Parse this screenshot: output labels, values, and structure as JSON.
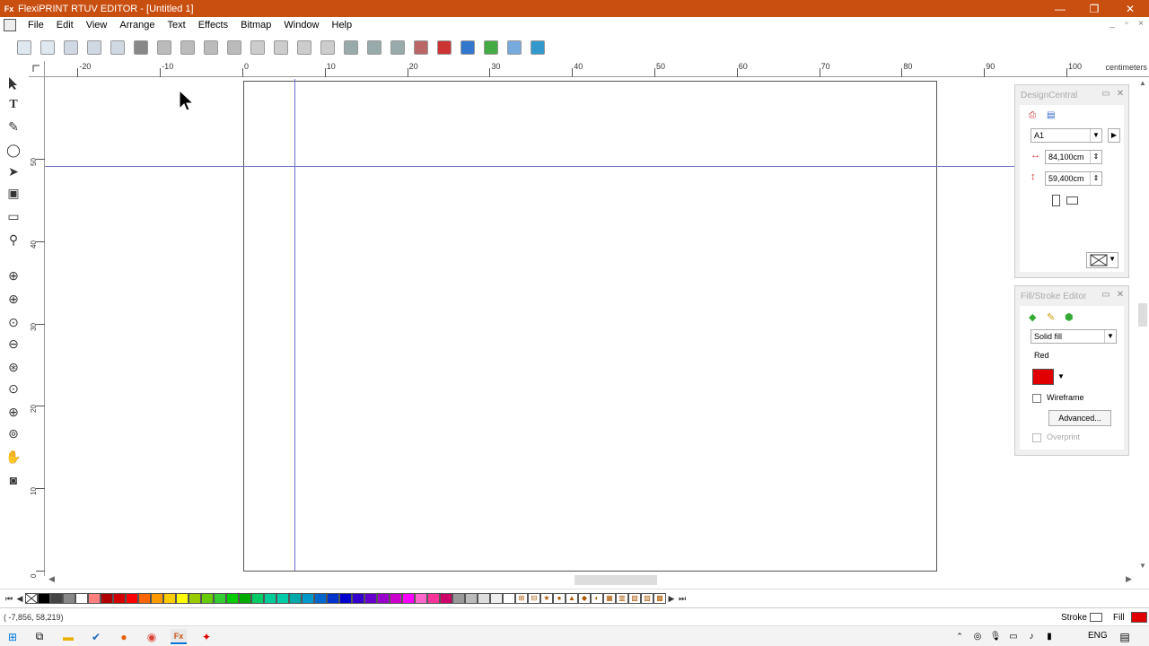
{
  "window": {
    "app_icon": "Fx",
    "title": "FlexiPRINT RTUV EDITOR - [Untitled 1]",
    "controls": {
      "minimize": "—",
      "maximize": "❐",
      "close": "✕"
    }
  },
  "menu": {
    "items": [
      "File",
      "Edit",
      "View",
      "Arrange",
      "Text",
      "Effects",
      "Bitmap",
      "Window",
      "Help"
    ]
  },
  "toolbar": {
    "buttons": [
      "new-document-icon",
      "open-icon",
      "save-icon",
      "import-icon",
      "export-icon",
      "print-icon",
      "cut-disabled-icon",
      "scissors-icon",
      "copy-icon",
      "paste-icon",
      "undo-icon",
      "undo-list-icon",
      "redo-icon",
      "redo-list-icon",
      "align-icon",
      "arrange-icon",
      "nest-icon",
      "rip-icon",
      "cut-contour-icon",
      "color-palette-icon",
      "spot-color-icon",
      "cloud-icon",
      "upload-icon"
    ]
  },
  "ruler": {
    "unit": "centimeters",
    "h_labels": [
      "-20",
      "-10",
      "0",
      "10",
      "20",
      "30",
      "40",
      "50",
      "60",
      "70",
      "80",
      "90",
      "100"
    ],
    "v_labels": [
      "50",
      "40",
      "30",
      "20",
      "10",
      "0"
    ]
  },
  "status": {
    "coordinates": "( -7,856, 58,219)",
    "stroke_label": "Stroke",
    "fill_label": "Fill",
    "fill_color": "#e00000"
  },
  "design_central": {
    "title": "DesignCentral",
    "page_size": "A1",
    "width": "84,100cm",
    "height": "59,400cm"
  },
  "fill_stroke_editor": {
    "title": "Fill/Stroke Editor",
    "fill_type": "Solid fill",
    "color_name": "Red",
    "color": "#e00000",
    "wireframe_label": "Wireframe",
    "advanced_label": "Advanced...",
    "overprint_label": "Overprint"
  },
  "palette": {
    "colors": [
      "#000000",
      "#444444",
      "#888888",
      "#ffffff",
      "#ff7f7f",
      "#b00000",
      "#d00000",
      "#ff0000",
      "#ff6600",
      "#ff9900",
      "#ffcc00",
      "#ffff00",
      "#99cc00",
      "#66cc00",
      "#33cc33",
      "#00cc00",
      "#00aa00",
      "#00cc66",
      "#00cc99",
      "#00ccaa",
      "#00aaaa",
      "#0099cc",
      "#0066cc",
      "#0033cc",
      "#0000cc",
      "#3300cc",
      "#6600cc",
      "#9900cc",
      "#cc00cc",
      "#ff00ff",
      "#ff66cc",
      "#ff3399",
      "#cc0066",
      "#999999",
      "#bbbbbb",
      "#dddddd",
      "#eeeeee",
      "#ffffff"
    ]
  },
  "taskbar": {
    "language": "ENG",
    "apps": [
      "start-icon",
      "task-view-icon",
      "file-explorer-icon",
      "edge-icon",
      "firefox-icon",
      "chrome-icon",
      "flexi-icon",
      "acrobat-icon"
    ]
  }
}
